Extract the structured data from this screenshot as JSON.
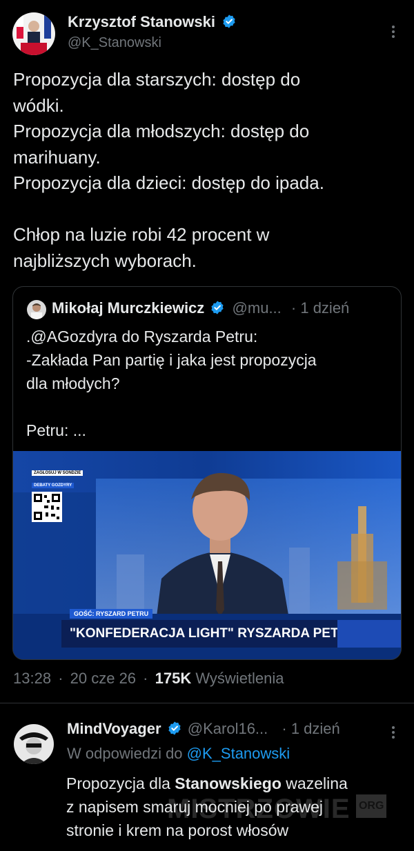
{
  "tweet": {
    "author_name": "Krzysztof Stanowski",
    "handle": "@K_Stanowski",
    "body_lines": [
      "Propozycja dla starszych: dostęp do",
      "wódki.",
      "Propozycja dla młodszych: dostęp do",
      "marihuany.",
      "Propozycja dla dzieci: dostęp do ipada.",
      "",
      "Chłop na luzie robi 42 procent w",
      "najbliższych wyborach."
    ],
    "time": "13:28",
    "date": "20 cze 26",
    "views_count": "175K",
    "views_label": "Wyświetlenia",
    "sep": "·"
  },
  "quote": {
    "author_name": "Mikołaj Murczkiewicz",
    "handle": "@mu...",
    "time": "· 1 dzień",
    "body_lines": [
      ".@AGozdyra do Ryszarda Petru:",
      "-Zakłada Pan partię i jaka jest propozycja",
      "dla młodych?",
      "",
      "Petru: ..."
    ],
    "video": {
      "qr_label_1": "ZAGŁOSUJ W SONDZIE",
      "qr_label_2": "DEBATY GOZDYRY",
      "guest_label": "GOŚĆ: RYSZARD PETRU",
      "headline": "\"KONFEDERACJA LIGHT\" RYSZARDA PETRU"
    }
  },
  "reply": {
    "author_name": "MindVoyager",
    "handle": "@Karol16...",
    "time": "· 1 dzień",
    "reply_to_prefix": "W odpowiedzi do",
    "reply_to_handle": "@K_Stanowski",
    "line1_a": "Propozycja dla ",
    "line1_b": "Stanowskiego",
    "line1_c": " wazelina",
    "line2": "z napisem smaruj mocniej po prawej",
    "line3": "stronie i krem na porost włosów"
  },
  "watermark": {
    "text": "MISTRZOWIE",
    "suffix": "ORG"
  },
  "colors": {
    "background": "#000000",
    "text": "#e7e9ea",
    "muted": "#71767b",
    "link": "#1d9bf0",
    "verified": "#1d9bf0",
    "border": "#2f3336"
  }
}
